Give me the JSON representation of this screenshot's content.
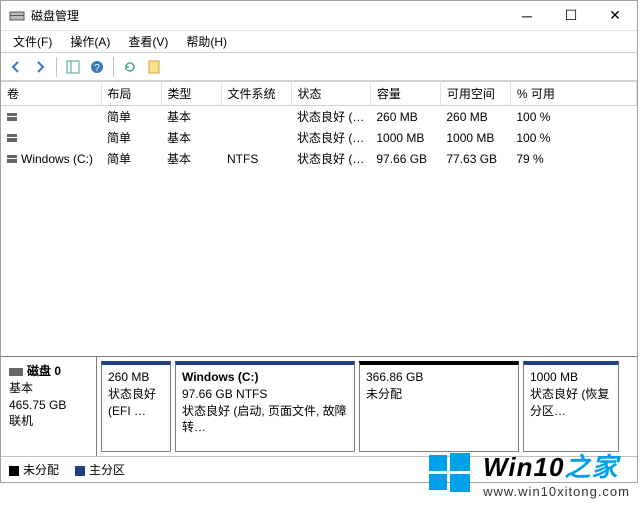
{
  "window": {
    "title": "磁盘管理"
  },
  "menu": {
    "file": "文件(F)",
    "action": "操作(A)",
    "view": "查看(V)",
    "help": "帮助(H)"
  },
  "headers": {
    "volume": "卷",
    "layout": "布局",
    "type": "类型",
    "fs": "文件系统",
    "status": "状态",
    "capacity": "容量",
    "free": "可用空间",
    "pct": "% 可用"
  },
  "rows": [
    {
      "name": "",
      "layout": "简单",
      "type": "基本",
      "fs": "",
      "status": "状态良好 (…",
      "capacity": "260 MB",
      "free": "260 MB",
      "pct": "100 %"
    },
    {
      "name": "",
      "layout": "简单",
      "type": "基本",
      "fs": "",
      "status": "状态良好 (…",
      "capacity": "1000 MB",
      "free": "1000 MB",
      "pct": "100 %"
    },
    {
      "name": "Windows (C:)",
      "layout": "简单",
      "type": "基本",
      "fs": "NTFS",
      "status": "状态良好 (…",
      "capacity": "97.66 GB",
      "free": "77.63 GB",
      "pct": "79 %"
    }
  ],
  "disk": {
    "label": "磁盘 0",
    "type": "基本",
    "size": "465.75 GB",
    "status": "联机",
    "parts": [
      {
        "title": "",
        "line1": "260 MB",
        "line2": "状态良好 (EFI …",
        "kind": "primary",
        "w": 70
      },
      {
        "title": "Windows  (C:)",
        "line1": "97.66 GB NTFS",
        "line2": "状态良好 (启动, 页面文件, 故障转…",
        "kind": "primary",
        "w": 180
      },
      {
        "title": "",
        "line1": "366.86 GB",
        "line2": "未分配",
        "kind": "unalloc",
        "w": 160
      },
      {
        "title": "",
        "line1": "1000 MB",
        "line2": "状态良好 (恢复分区…",
        "kind": "primary",
        "w": 96
      }
    ]
  },
  "legend": {
    "unalloc": "未分配",
    "primary": "主分区"
  },
  "watermark": {
    "brand1": "Win10",
    "brand2": "之家",
    "url": "www.win10xitong.com"
  },
  "colors": {
    "primary": "#204080",
    "unalloc": "#000000",
    "accent": "#00a0e8"
  }
}
